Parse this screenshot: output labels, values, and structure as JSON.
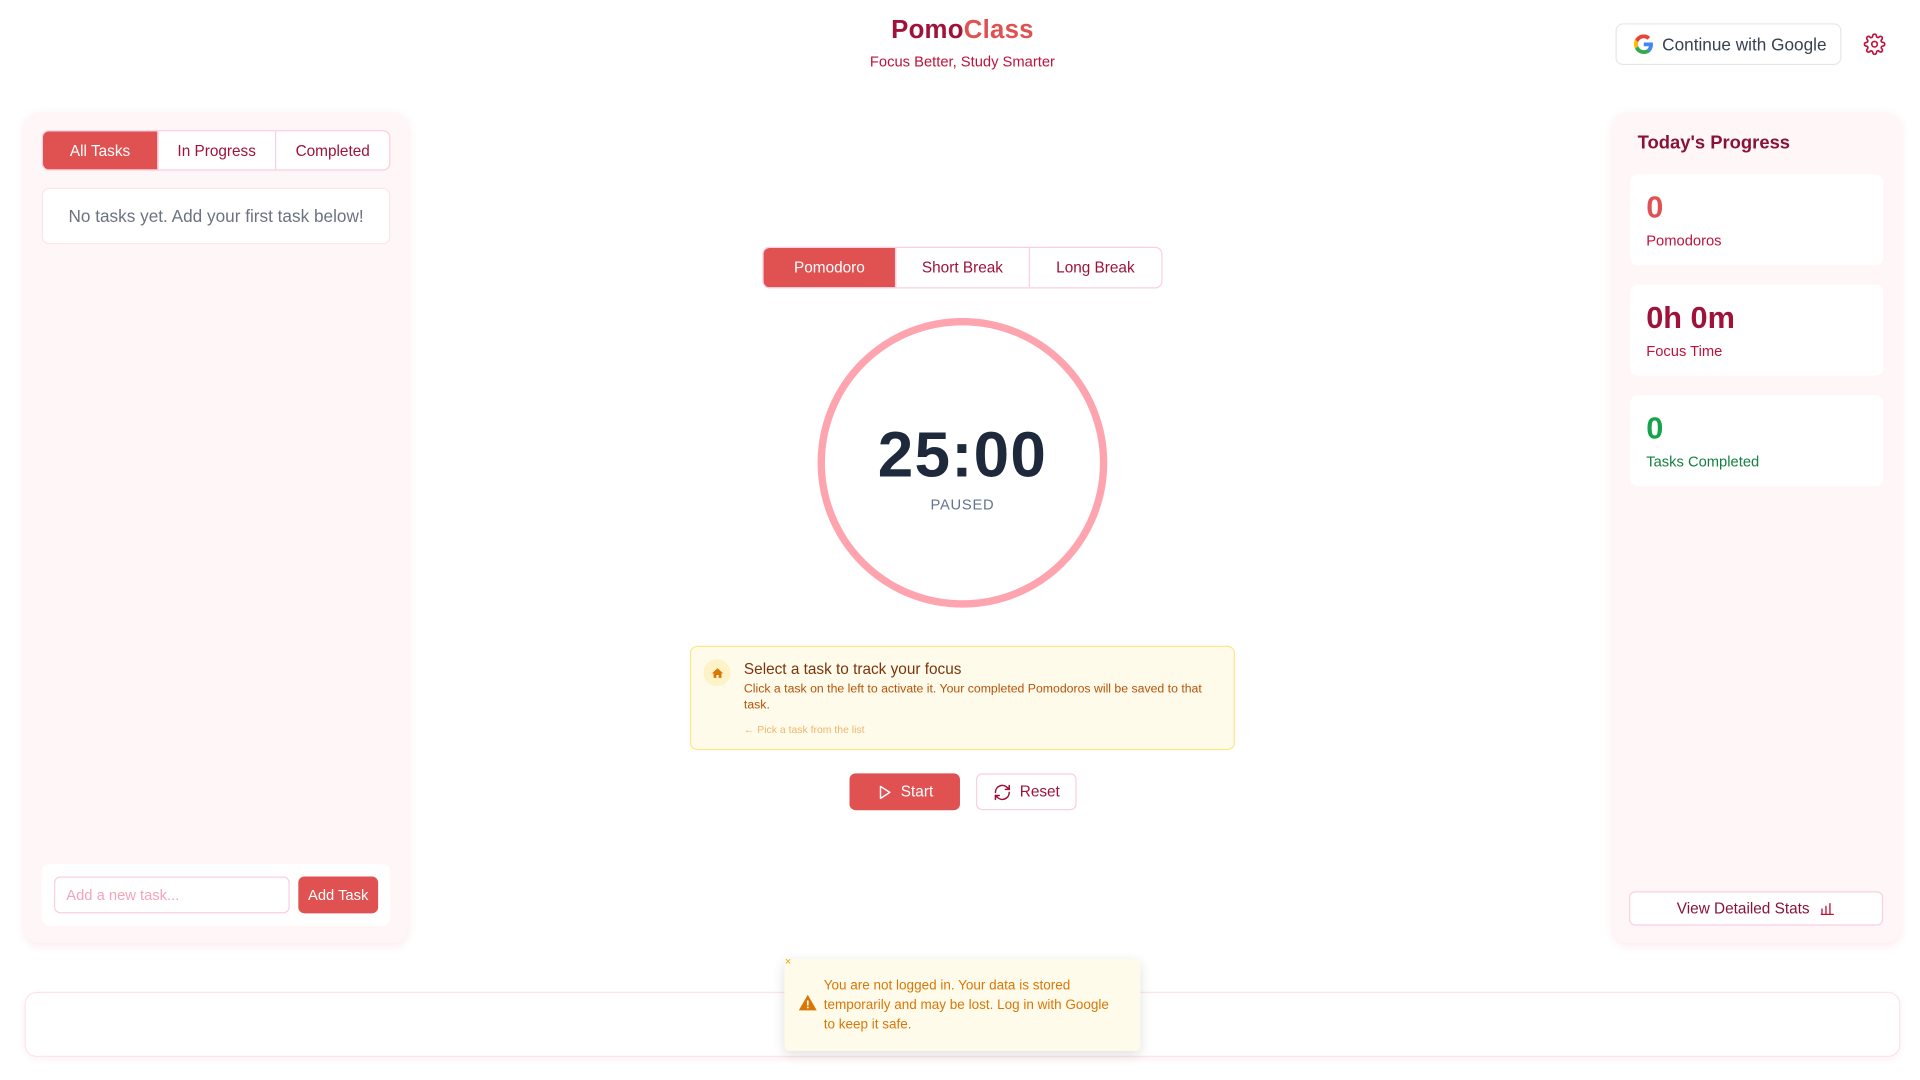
{
  "header": {
    "brand_part1": "Pomo",
    "brand_part2": "Class",
    "tagline": "Focus Better, Study Smarter",
    "google_button": "Continue with Google"
  },
  "tasks_panel": {
    "tabs": [
      "All Tasks",
      "In Progress",
      "Completed"
    ],
    "active_tab": "All Tasks",
    "empty_message": "No tasks yet. Add your first task below!",
    "input_placeholder": "Add a new task...",
    "add_button": "Add Task"
  },
  "timer": {
    "modes": [
      "Pomodoro",
      "Short Break",
      "Long Break"
    ],
    "active_mode": "Pomodoro",
    "time": "25:00",
    "status": "PAUSED",
    "hint_title": "Select a task to track your focus",
    "hint_body": "Click a task on the left to activate it. Your completed Pomodoros will be saved to that task.",
    "hint_footer": "← Pick a task from the list",
    "start_button": "Start",
    "reset_button": "Reset"
  },
  "progress": {
    "title": "Today's Progress",
    "pomodoros_value": "0",
    "pomodoros_label": "Pomodoros",
    "focus_value": "0h 0m",
    "focus_label": "Focus Time",
    "tasks_value": "0",
    "tasks_label": "Tasks Completed",
    "stats_button": "View Detailed Stats"
  },
  "toast": {
    "message": "You are not logged in. Your data is stored temporarily and may be lost. Log in with Google to keep it safe."
  },
  "colors": {
    "primary": "#e05252",
    "dark_rose": "#9f1239",
    "success": "#16a34a",
    "warning": "#d97706"
  }
}
